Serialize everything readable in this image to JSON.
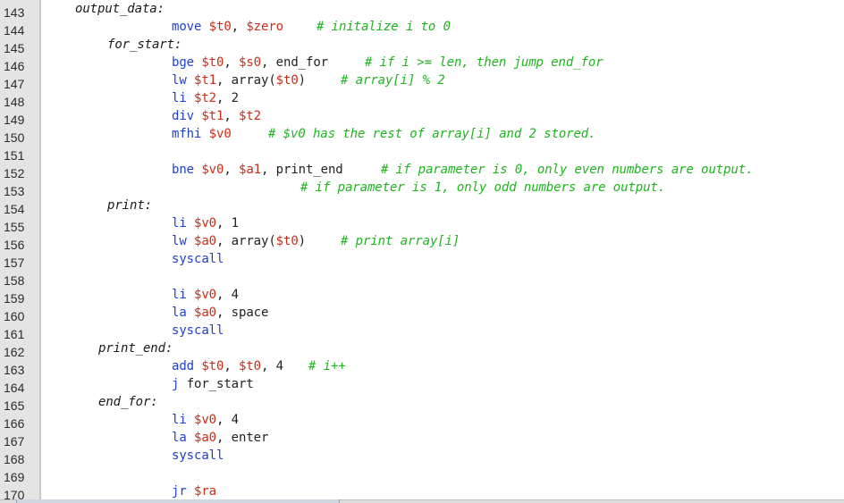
{
  "editor": {
    "lines": [
      {
        "num": "143",
        "label": "output_data:"
      },
      {
        "num": "144",
        "instr": "move",
        "args": [
          {
            "t": "reg",
            "v": "$t0"
          },
          {
            "t": "txt",
            "v": ", "
          },
          {
            "t": "reg",
            "v": "$zero"
          }
        ],
        "comment": "# initalize i to 0"
      },
      {
        "num": "145",
        "label": "for_start:"
      },
      {
        "num": "146",
        "instr": "bge",
        "args": [
          {
            "t": "reg",
            "v": "$t0"
          },
          {
            "t": "txt",
            "v": ", "
          },
          {
            "t": "reg",
            "v": "$s0"
          },
          {
            "t": "txt",
            "v": ", end_for"
          }
        ],
        "comment": "# if i >= len, then jump end_for"
      },
      {
        "num": "147",
        "instr": "lw",
        "args": [
          {
            "t": "reg",
            "v": "$t1"
          },
          {
            "t": "txt",
            "v": ", array("
          },
          {
            "t": "reg",
            "v": "$t0"
          },
          {
            "t": "txt",
            "v": ")"
          }
        ],
        "comment": "# array[i] % 2"
      },
      {
        "num": "148",
        "instr": "li",
        "args": [
          {
            "t": "reg",
            "v": "$t2"
          },
          {
            "t": "txt",
            "v": ", 2"
          }
        ]
      },
      {
        "num": "149",
        "instr": "div",
        "args": [
          {
            "t": "reg",
            "v": "$t1"
          },
          {
            "t": "txt",
            "v": ", "
          },
          {
            "t": "reg",
            "v": "$t2"
          }
        ]
      },
      {
        "num": "150",
        "instr": "mfhi",
        "args": [
          {
            "t": "reg",
            "v": "$v0"
          }
        ],
        "comment": "# $v0 has the rest of array[i] and 2 stored."
      },
      {
        "num": "151"
      },
      {
        "num": "152",
        "instr": "bne",
        "args": [
          {
            "t": "reg",
            "v": "$v0"
          },
          {
            "t": "txt",
            "v": ", "
          },
          {
            "t": "reg",
            "v": "$a1"
          },
          {
            "t": "txt",
            "v": ", print_end"
          }
        ],
        "comment": "# if parameter is 0, only even numbers are output."
      },
      {
        "num": "153",
        "comment": "# if parameter is 1, only odd numbers are output."
      },
      {
        "num": "154",
        "label": "print:"
      },
      {
        "num": "155",
        "instr": "li",
        "args": [
          {
            "t": "reg",
            "v": "$v0"
          },
          {
            "t": "txt",
            "v": ", 1"
          }
        ]
      },
      {
        "num": "156",
        "instr": "lw",
        "args": [
          {
            "t": "reg",
            "v": "$a0"
          },
          {
            "t": "txt",
            "v": ", array("
          },
          {
            "t": "reg",
            "v": "$t0"
          },
          {
            "t": "txt",
            "v": ")"
          }
        ],
        "comment": "# print array[i]"
      },
      {
        "num": "157",
        "instr": "syscall"
      },
      {
        "num": "158"
      },
      {
        "num": "159",
        "instr": "li",
        "args": [
          {
            "t": "reg",
            "v": "$v0"
          },
          {
            "t": "txt",
            "v": ", 4"
          }
        ]
      },
      {
        "num": "160",
        "instr": "la",
        "args": [
          {
            "t": "reg",
            "v": "$a0"
          },
          {
            "t": "txt",
            "v": ", space"
          }
        ]
      },
      {
        "num": "161",
        "instr": "syscall"
      },
      {
        "num": "162",
        "label": "print_end:"
      },
      {
        "num": "163",
        "instr": "add",
        "args": [
          {
            "t": "reg",
            "v": "$t0"
          },
          {
            "t": "txt",
            "v": ", "
          },
          {
            "t": "reg",
            "v": "$t0"
          },
          {
            "t": "txt",
            "v": ", 4"
          }
        ],
        "comment": "# i++"
      },
      {
        "num": "164",
        "instr": "j",
        "args": [
          {
            "t": "txt",
            "v": "for_start"
          }
        ]
      },
      {
        "num": "165",
        "label": "end_for:"
      },
      {
        "num": "166",
        "instr": "li",
        "args": [
          {
            "t": "reg",
            "v": "$v0"
          },
          {
            "t": "txt",
            "v": ", 4"
          }
        ]
      },
      {
        "num": "167",
        "instr": "la",
        "args": [
          {
            "t": "reg",
            "v": "$a0"
          },
          {
            "t": "txt",
            "v": ", enter"
          }
        ]
      },
      {
        "num": "168",
        "instr": "syscall"
      },
      {
        "num": "169"
      },
      {
        "num": "170",
        "instr": "jr",
        "args": [
          {
            "t": "reg",
            "v": "$ra"
          }
        ]
      }
    ]
  }
}
